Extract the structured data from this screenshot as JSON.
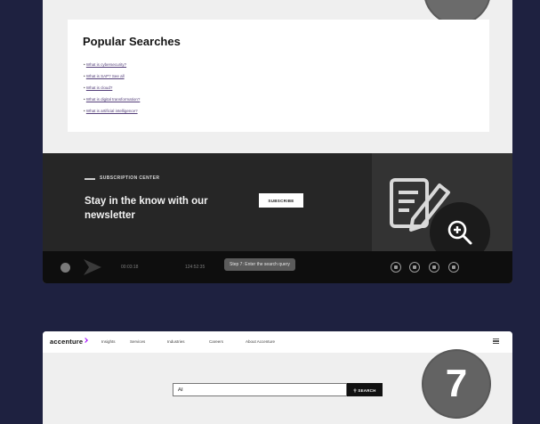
{
  "colors": {
    "page_background": "#1e2140",
    "card_background": "#efefef",
    "dark_panel": "#262626",
    "brand_accent": "#a100ff",
    "step_badge": "#636363"
  },
  "top_card": {
    "popular": {
      "title": "Popular Searches",
      "items": [
        "What is cybersecurity?",
        "What is SAP? See all",
        "What is cloud?",
        "What is digital transformation?",
        "What is artificial intelligence?"
      ]
    },
    "subscription": {
      "center_label": "SUBSCRIPTION CENTER",
      "headline": "Stay in the know with our newsletter",
      "subscribe_label": "SUBSCRIBE",
      "illustration_icon": "document-edit-icon"
    },
    "zoom_icon": "zoom-in-icon",
    "video_bar": {
      "play_icon": "play-icon",
      "time_elapsed": "00:03:18",
      "time_total": "124:52:35",
      "tooltip": "Step 7: Enter the search query",
      "social_icons": [
        "instagram-icon",
        "facebook-icon",
        "linkedin-icon",
        "youtube-icon"
      ]
    }
  },
  "bottom_card": {
    "logo": "accenture",
    "nav": [
      "Insights",
      "Services",
      "Industries",
      "Careers",
      "About Accenture"
    ],
    "menu_icon": "menu-icon",
    "search": {
      "value": "AI",
      "button_label": "SEARCH"
    },
    "step_number": "7"
  }
}
